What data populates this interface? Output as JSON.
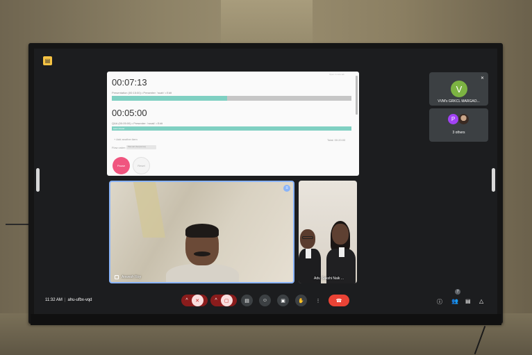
{
  "timer": {
    "top_link": "Open in new tab",
    "items": [
      {
        "time": "00:07:13",
        "meta": "Presentation (00:15:00)  •  Presenter: 'noah'  •  Edit",
        "progress": 0.48
      },
      {
        "time": "00:05:00",
        "meta": "Q&A (00:05:00)  •  Presenter: 'ronak'  •  Edit",
        "progress": 1.0,
        "bar_label": "Last minute!"
      }
    ],
    "add_item": "+ Add another item",
    "total": "Total: 00:20:00",
    "flow_label": "Flow order:",
    "flow_value": "Manual (Sequence)",
    "pause_label": "Pause",
    "reset_label": "Reset"
  },
  "tiles": {
    "main_name": "Anwesh Roy",
    "side_name": "Adv. Sakshi Naik ..."
  },
  "right_panel": {
    "v_initial": "V",
    "v_name": "VVM's GRKCL MARGAO...",
    "p_initial": "P",
    "others": "3 others"
  },
  "bottom": {
    "time": "11:32 AM",
    "meeting_code": "ahu-ufbx-vqd",
    "people_count": "7"
  },
  "icons": [
    "activity-icon",
    "mic-off-icon",
    "camera-off-icon",
    "captions-icon",
    "emoji-icon",
    "present-icon",
    "raise-hand-icon",
    "more-icon",
    "end-call-icon",
    "info-icon",
    "people-icon",
    "chat-icon",
    "activities-icon"
  ],
  "colors": {
    "accent": "#8ab4f8",
    "end_call": "#ea4335",
    "pause": "#f0557f",
    "progress": "#7fd0c2",
    "avatar_v": "#7cb342",
    "avatar_p": "#a142f4"
  }
}
